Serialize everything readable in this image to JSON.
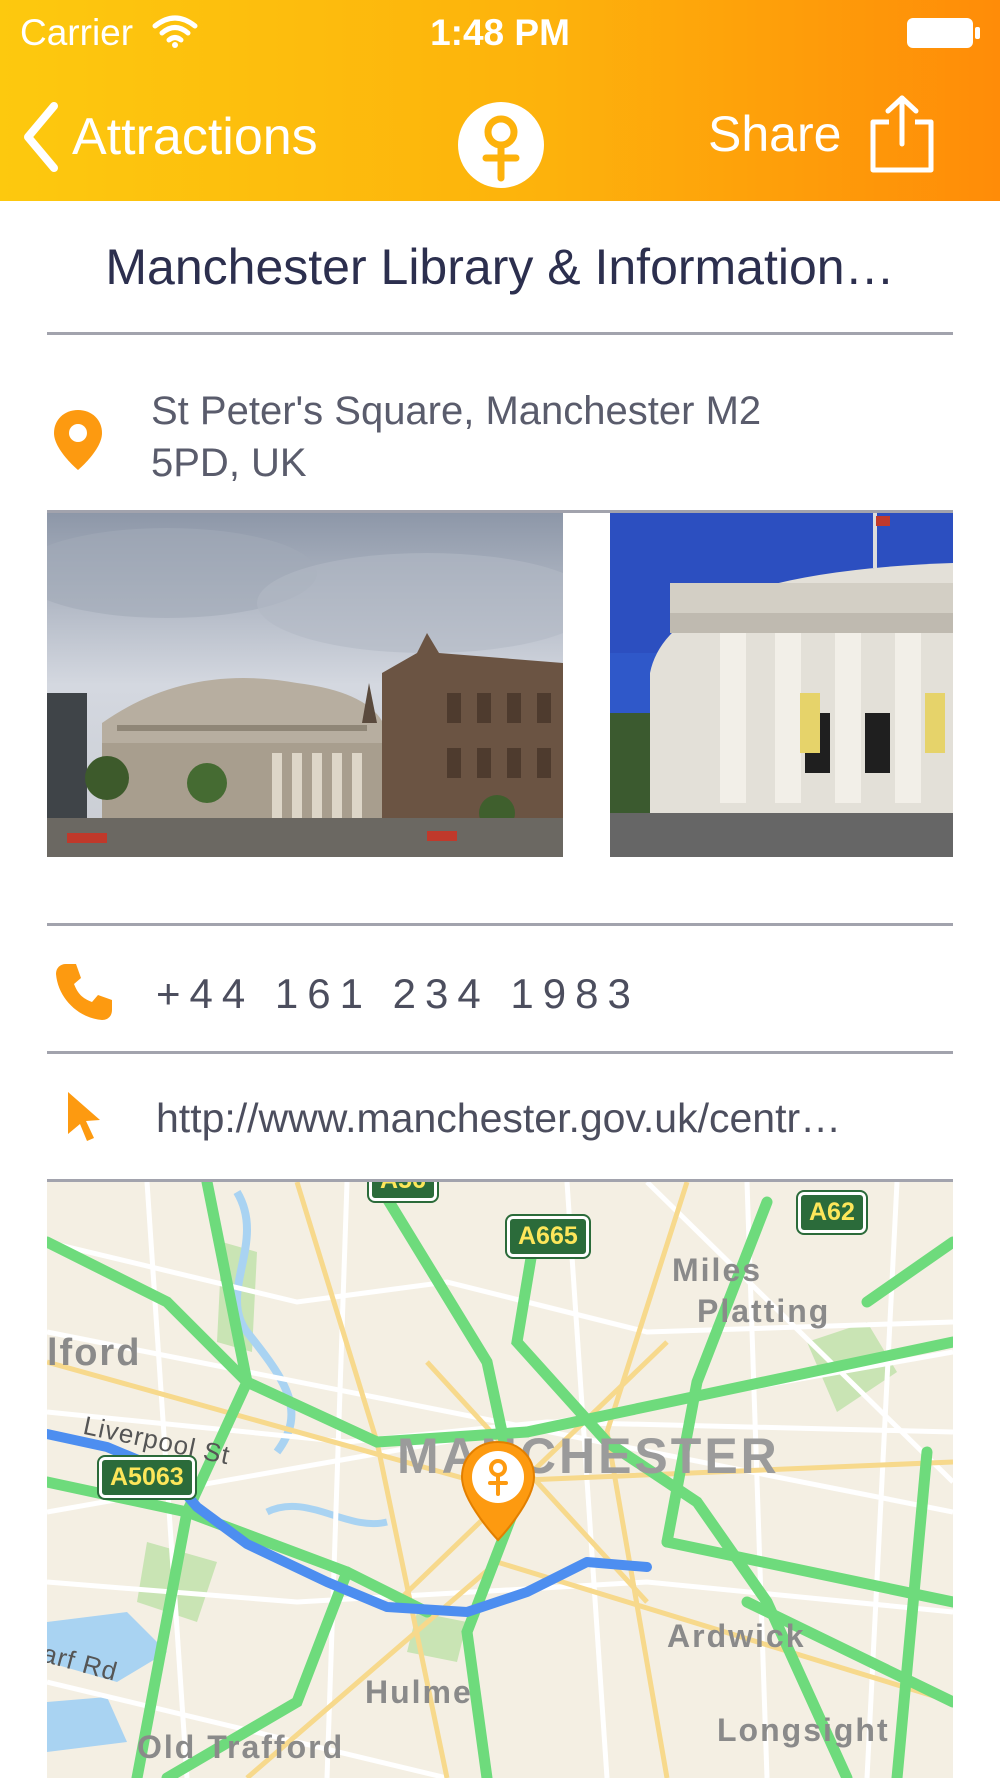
{
  "status_bar": {
    "carrier": "Carrier",
    "time": "1:48 PM"
  },
  "nav": {
    "back_label": "Attractions",
    "share_label": "Share"
  },
  "place": {
    "title": "Manchester Library & Information…",
    "address_line1": "St Peter's Square, Manchester M2",
    "address_line2": "5PD, UK",
    "phone": "+44 161 234 1983",
    "url": "http://www.manchester.gov.uk/centr…"
  },
  "map": {
    "city_label": "MANCHESTER",
    "areas": [
      "Miles",
      "Platting",
      "Ardwick",
      "Hulme",
      "Old Trafford",
      "Longsight",
      "lford"
    ],
    "streets": [
      "Liverpool St",
      "arf Rd"
    ],
    "roads": [
      "A665",
      "A62",
      "A5063",
      "A56"
    ]
  },
  "colors": {
    "accent": "#fd9a10",
    "header_start": "#fdc90e",
    "header_end": "#ff8c08",
    "title_text": "#2c2f4e",
    "route": "#4d8ef0"
  },
  "icons": [
    "chevron-left-icon",
    "app-logo-icon",
    "share-icon",
    "location-pin-icon",
    "phone-icon",
    "pointer-icon",
    "map-pin-icon"
  ]
}
